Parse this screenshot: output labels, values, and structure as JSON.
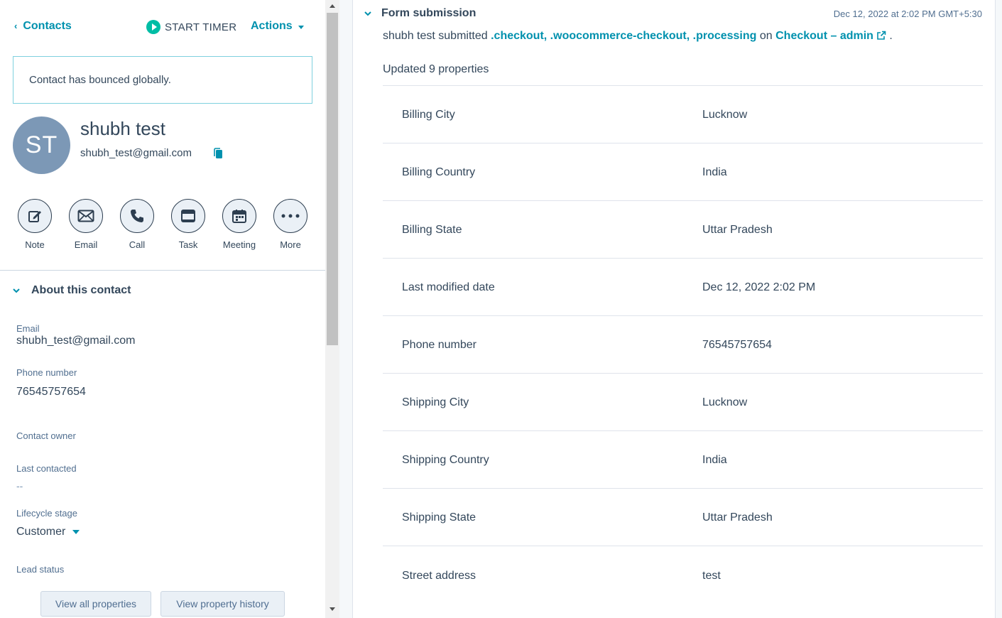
{
  "header": {
    "back_label": "Contacts",
    "timer_label": "START TIMER",
    "actions_label": "Actions"
  },
  "alert": {
    "text": "Contact has bounced globally."
  },
  "contact": {
    "initials": "ST",
    "name": "shubh test",
    "email": "shubh_test@gmail.com"
  },
  "quick_actions": [
    {
      "label": "Note",
      "icon": "note-icon"
    },
    {
      "label": "Email",
      "icon": "email-icon"
    },
    {
      "label": "Call",
      "icon": "call-icon"
    },
    {
      "label": "Task",
      "icon": "task-icon"
    },
    {
      "label": "Meeting",
      "icon": "meeting-icon"
    },
    {
      "label": "More",
      "icon": "more-icon"
    }
  ],
  "about": {
    "title": "About this contact",
    "email_label": "Email",
    "email_value": "shubh_test@gmail.com",
    "phone_label": "Phone number",
    "phone_value": "76545757654",
    "owner_label": "Contact owner",
    "last_contacted_label": "Last contacted",
    "last_contacted_value": "--",
    "lifecycle_label": "Lifecycle stage",
    "lifecycle_value": "Customer",
    "lead_status_label": "Lead status",
    "view_all_label": "View all properties",
    "view_history_label": "View property history"
  },
  "form_submission": {
    "title": "Form submission",
    "timestamp": "Dec 12, 2022 at 2:02 PM GMT+5:30",
    "submitter": "shubh test submitted",
    "form_link": ".checkout, .woocommerce-checkout, .processing",
    "on_text": "on",
    "page_link": "Checkout – admin",
    "trailing": ".",
    "updated_text": "Updated 9 properties",
    "properties": [
      {
        "name": "Billing City",
        "value": "Lucknow"
      },
      {
        "name": "Billing Country",
        "value": "India"
      },
      {
        "name": "Billing State",
        "value": "Uttar Pradesh"
      },
      {
        "name": "Last modified date",
        "value": "Dec 12, 2022 2:02 PM"
      },
      {
        "name": "Phone number",
        "value": "76545757654"
      },
      {
        "name": "Shipping City",
        "value": "Lucknow"
      },
      {
        "name": "Shipping Country",
        "value": "India"
      },
      {
        "name": "Shipping State",
        "value": "Uttar Pradesh"
      },
      {
        "name": "Street address",
        "value": "test"
      }
    ]
  },
  "colors": {
    "accent": "#0091ae",
    "text": "#33475b",
    "avatar": "#7c98b6",
    "timer_green": "#00bda5"
  }
}
